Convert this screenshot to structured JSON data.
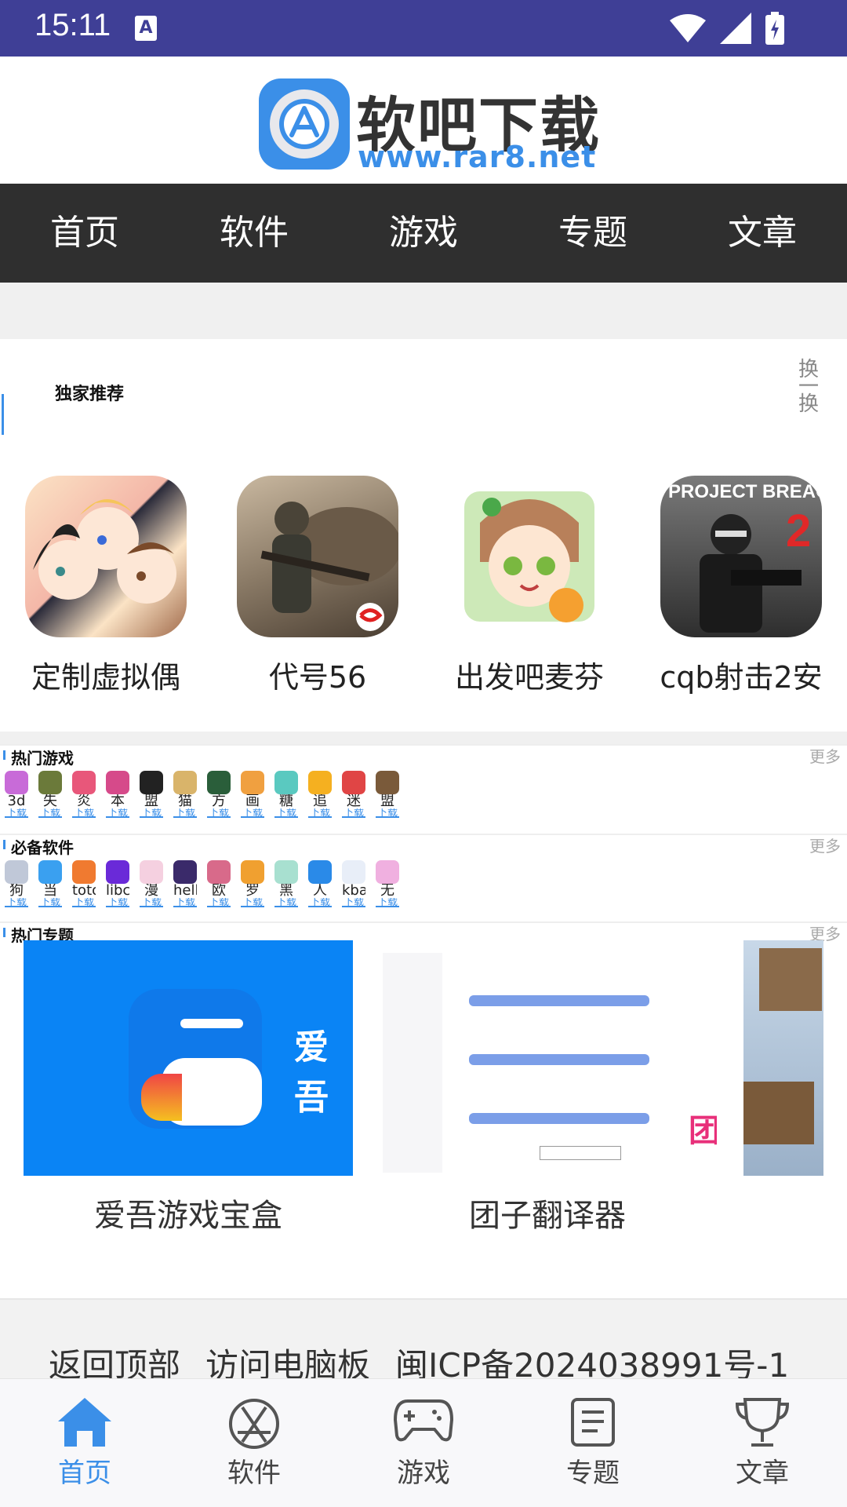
{
  "status_bar": {
    "time": "15:11",
    "icons": [
      "notification-a-icon",
      "wifi-icon",
      "signal-icon",
      "battery-charging-icon"
    ]
  },
  "header": {
    "logo_cn": "软吧下载",
    "logo_url": "www.rar8.net"
  },
  "top_nav": [
    "首页",
    "软件",
    "游戏",
    "专题",
    "文章"
  ],
  "exclusive": {
    "title": "独家推荐",
    "swap": "换一换",
    "apps": [
      {
        "name": "定制虚拟偶",
        "color": "#f5c9b3"
      },
      {
        "name": "代号56",
        "color": "#7a6c5c"
      },
      {
        "name": "出发吧麦芬",
        "color": "#c9e7b0"
      },
      {
        "name": "cqb射击2安",
        "color": "#3c3c3c"
      }
    ]
  },
  "hot_games": {
    "title": "热门游戏",
    "more": "更多",
    "button": "下载",
    "items": [
      {
        "name": "3d",
        "color": "#c86bd8"
      },
      {
        "name": "失",
        "color": "#6b7a3a"
      },
      {
        "name": "炎",
        "color": "#e8577a"
      },
      {
        "name": "本",
        "color": "#d64a8a"
      },
      {
        "name": "盟",
        "color": "#222222"
      },
      {
        "name": "猫",
        "color": "#d9b46a"
      },
      {
        "name": "方",
        "color": "#2a5e3a"
      },
      {
        "name": "画",
        "color": "#f0a040"
      },
      {
        "name": "糖",
        "color": "#5ac9c0"
      },
      {
        "name": "追",
        "color": "#f5b020"
      },
      {
        "name": "迷",
        "color": "#e04545"
      },
      {
        "name": "盟",
        "color": "#7a5a3a"
      }
    ]
  },
  "must_have": {
    "title": "必备软件",
    "more": "更多",
    "button": "下载",
    "items": [
      {
        "name": "狗",
        "color": "#c0c8d8"
      },
      {
        "name": "当",
        "color": "#3aa0f0"
      },
      {
        "name": "toto",
        "color": "#f07a30"
      },
      {
        "name": "libcl",
        "color": "#6a2ad8"
      },
      {
        "name": "漫",
        "color": "#f5d0e0"
      },
      {
        "name": "hello",
        "color": "#3a2a6a"
      },
      {
        "name": "欧",
        "color": "#d86a8a"
      },
      {
        "name": "罗",
        "color": "#f0a030"
      },
      {
        "name": "黑",
        "color": "#a8e0d0"
      },
      {
        "name": "人",
        "color": "#2a8ae8"
      },
      {
        "name": "kba",
        "color": "#e8eef8"
      },
      {
        "name": "无",
        "color": "#f0b0e0"
      }
    ]
  },
  "hot_topics": {
    "title": "热门专题",
    "more": "更多",
    "items": [
      {
        "name": "爱吾游戏宝盒",
        "banner_text": "爱吾"
      },
      {
        "name": "团子翻译器",
        "banner_text": "团"
      }
    ]
  },
  "footer": {
    "links": [
      "返回顶部",
      "访问电脑板",
      "闽ICP备2024038991号-1"
    ]
  },
  "tab_bar": [
    {
      "label": "首页",
      "icon": "home-icon",
      "active": true
    },
    {
      "label": "软件",
      "icon": "app-store-icon",
      "active": false
    },
    {
      "label": "游戏",
      "icon": "gamepad-icon",
      "active": false
    },
    {
      "label": "专题",
      "icon": "document-icon",
      "active": false
    },
    {
      "label": "文章",
      "icon": "trophy-icon",
      "active": false
    }
  ],
  "colors": {
    "accent": "#3b8fe8",
    "status_bar": "#3f3f96",
    "nav_bg": "#2f2f2f"
  }
}
